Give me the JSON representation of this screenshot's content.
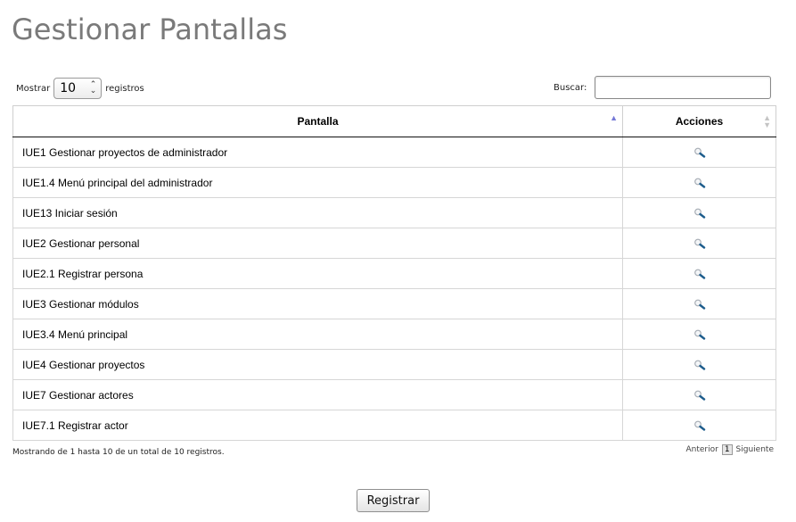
{
  "page": {
    "title": "Gestionar Pantallas"
  },
  "length_control": {
    "prefix": "Mostrar",
    "value": "10",
    "suffix": "registros"
  },
  "search": {
    "label": "Buscar:",
    "value": "",
    "placeholder": ""
  },
  "table": {
    "columns": [
      "Pantalla",
      "Acciones"
    ],
    "rows": [
      "IUE1 Gestionar proyectos de administrador",
      "IUE1.4 Menú principal del administrador",
      "IUE13 Iniciar sesión",
      "IUE2 Gestionar personal",
      "IUE2.1 Registrar persona",
      "IUE3 Gestionar módulos",
      "IUE3.4 Menú principal",
      "IUE4 Gestionar proyectos",
      "IUE7 Gestionar actores",
      "IUE7.1 Registrar actor"
    ],
    "action_icon": "magnifier-icon"
  },
  "footer": {
    "info": "Mostrando de 1 hasta 10 de un total de 10 registros."
  },
  "pagination": {
    "previous": "Anterior",
    "current": "1",
    "next": "Siguiente"
  },
  "actions": {
    "register_label": "Registrar"
  },
  "colors": {
    "title": "#7a7a7a",
    "sort_active": "#7478d6",
    "icon_handle": "#1e5d8c"
  }
}
